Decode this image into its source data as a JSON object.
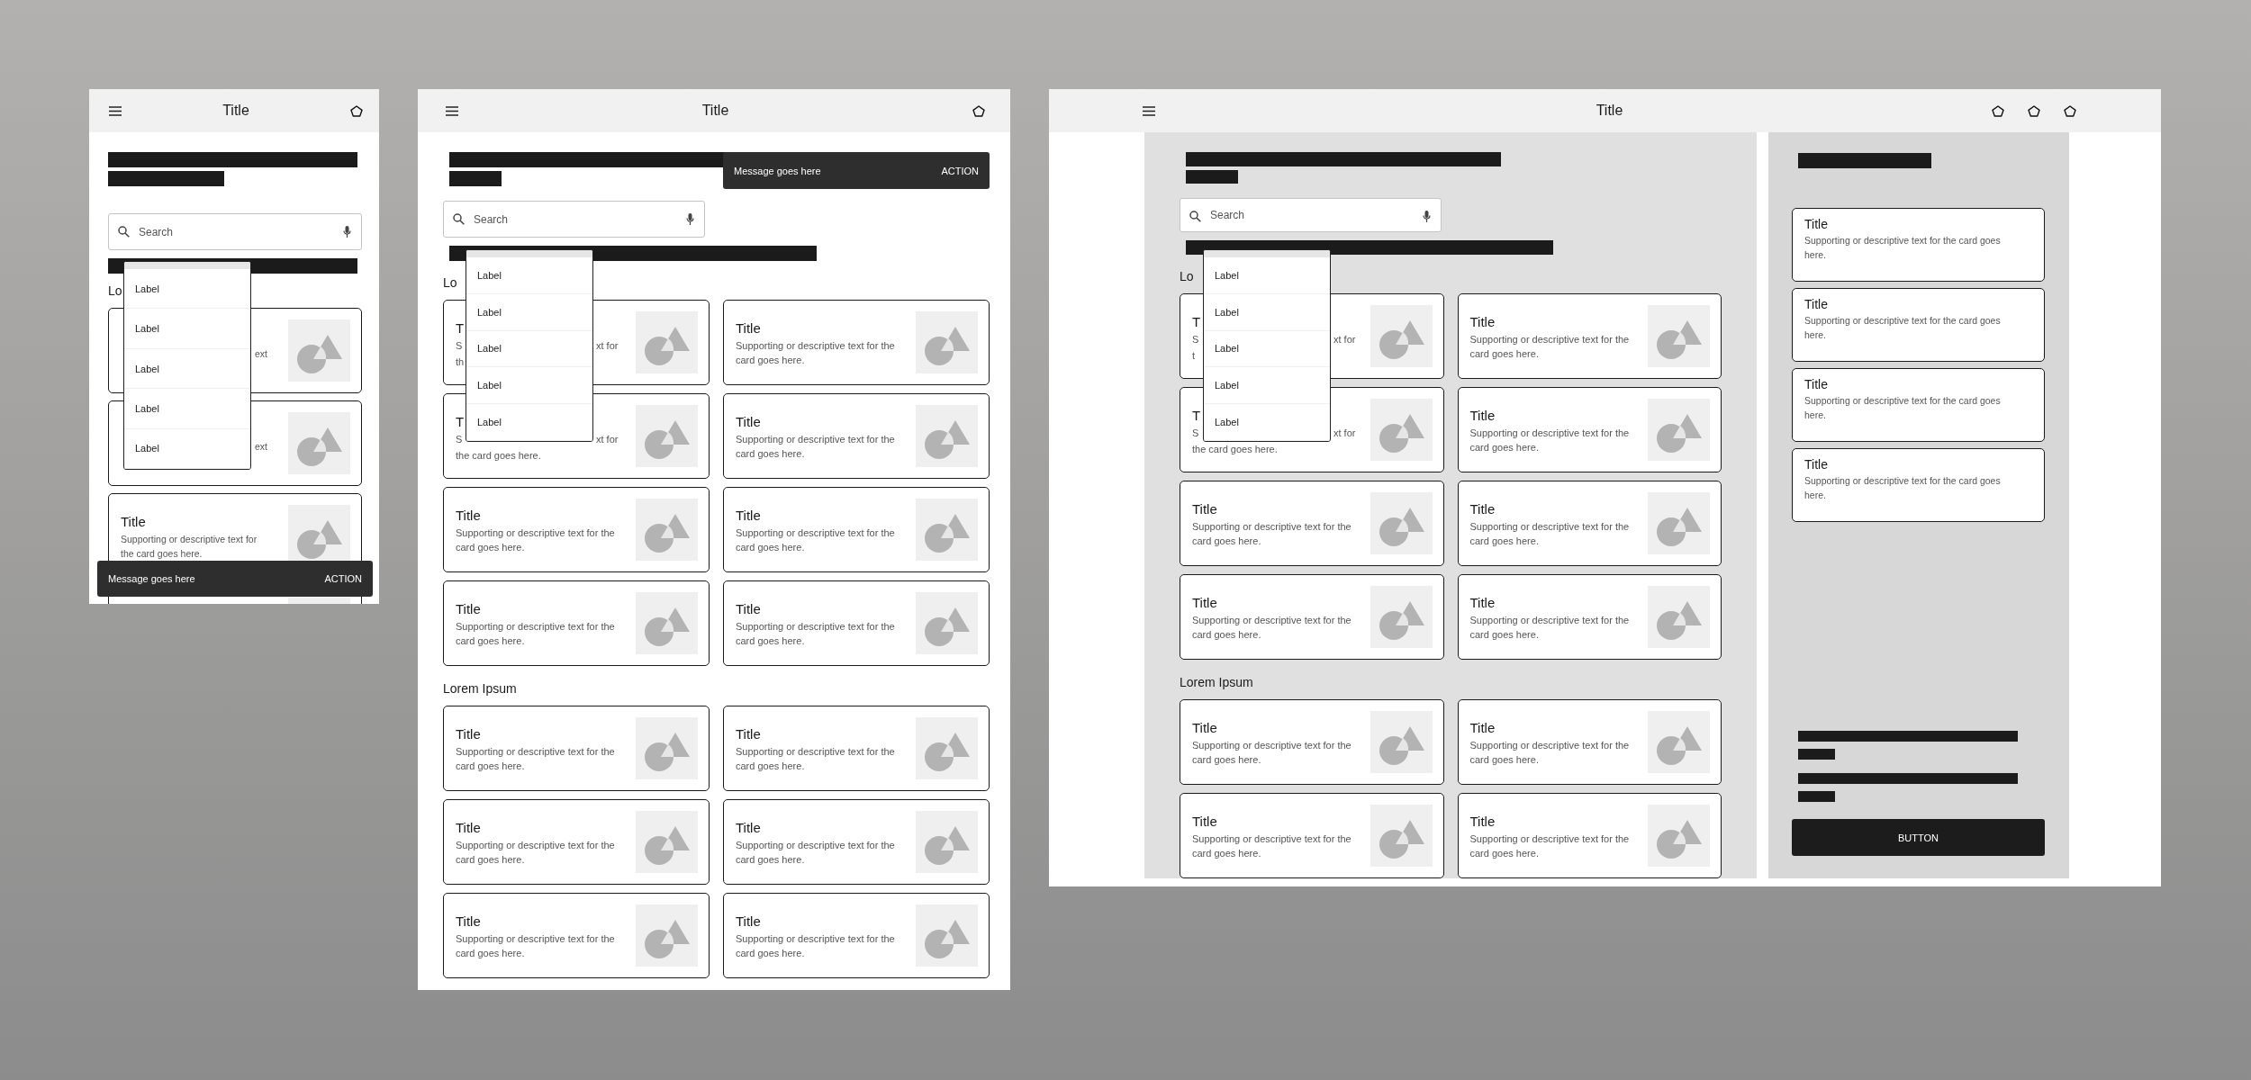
{
  "screens": [
    {
      "kind": "mobile",
      "title": "Title",
      "search": {
        "placeholder": "Search"
      },
      "menu": {
        "items": [
          {
            "label": "Label"
          },
          {
            "label": "Label"
          },
          {
            "label": "Label"
          },
          {
            "label": "Label"
          },
          {
            "label": "Label"
          }
        ]
      },
      "sections": [
        {
          "heading": "Lo",
          "cards": [
            {
              "kind": "covered",
              "lines": [
                {
                  "right": "ext"
                }
              ]
            },
            {
              "kind": "covered",
              "lines": [
                {
                  "right": "ext"
                }
              ]
            },
            {
              "kind": "full",
              "title": "Title",
              "text": "Supporting or descriptive text for the card goes here."
            },
            {
              "kind": "cut"
            }
          ]
        }
      ],
      "snackbar": {
        "message": "Message goes here",
        "action": "ACTION"
      }
    },
    {
      "kind": "tablet",
      "title": "Title",
      "search": {
        "placeholder": "Search"
      },
      "menu": {
        "items": [
          {
            "label": "Label"
          },
          {
            "label": "Label"
          },
          {
            "label": "Label"
          },
          {
            "label": "Label"
          },
          {
            "label": "Label"
          }
        ]
      },
      "sections": [
        {
          "heading": "Lo",
          "cards": [
            {
              "kind": "covered",
              "title": "T",
              "lines": [
                {
                  "left": "S",
                  "right": "xt for"
                },
                {
                  "left": "th"
                }
              ]
            },
            {
              "kind": "full",
              "title": "Title",
              "text": "Supporting or descriptive text for the card goes here."
            },
            {
              "kind": "covered",
              "title": "T",
              "lines": [
                {
                  "left": "S",
                  "right": "xt for"
                },
                {
                  "left": "the card goes here."
                }
              ]
            },
            {
              "kind": "full",
              "title": "Title",
              "text": "Supporting or descriptive text for the card goes here."
            },
            {
              "kind": "full",
              "title": "Title",
              "text": "Supporting or descriptive text for the card goes here."
            },
            {
              "kind": "full",
              "title": "Title",
              "text": "Supporting or descriptive text for the card goes here."
            },
            {
              "kind": "full",
              "title": "Title",
              "text": "Supporting or descriptive text for the card goes here."
            },
            {
              "kind": "full",
              "title": "Title",
              "text": "Supporting or descriptive text for the card goes here."
            }
          ]
        },
        {
          "heading": "Lorem Ipsum",
          "cards": [
            {
              "kind": "full",
              "title": "Title",
              "text": "Supporting or descriptive text for the card goes here."
            },
            {
              "kind": "full",
              "title": "Title",
              "text": "Supporting or descriptive text for the card goes here."
            },
            {
              "kind": "full",
              "title": "Title",
              "text": "Supporting or descriptive text for the card goes here."
            },
            {
              "kind": "full",
              "title": "Title",
              "text": "Supporting or descriptive text for the card goes here."
            },
            {
              "kind": "full",
              "title": "Title",
              "text": "Supporting or descriptive text for the card goes here."
            },
            {
              "kind": "full",
              "title": "Title",
              "text": "Supporting or descriptive text for the card goes here."
            }
          ]
        }
      ],
      "snackbar": {
        "message": "Message goes here",
        "action": "ACTION"
      }
    },
    {
      "kind": "desktop",
      "title": "Title",
      "search": {
        "placeholder": "Search"
      },
      "menu": {
        "items": [
          {
            "label": "Label"
          },
          {
            "label": "Label"
          },
          {
            "label": "Label"
          },
          {
            "label": "Label"
          },
          {
            "label": "Label"
          }
        ]
      },
      "sections": [
        {
          "heading": "Lo",
          "cards": [
            {
              "kind": "covered",
              "title": "T",
              "lines": [
                {
                  "left": "S",
                  "right": "xt for"
                },
                {
                  "left": "t"
                }
              ]
            },
            {
              "kind": "full",
              "title": "Title",
              "text": "Supporting or descriptive text for the card goes here."
            },
            {
              "kind": "covered",
              "title": "T",
              "lines": [
                {
                  "left": "S",
                  "right": "xt for"
                },
                {
                  "left": "the card goes here."
                }
              ]
            },
            {
              "kind": "full",
              "title": "Title",
              "text": "Supporting or descriptive text for the card goes here."
            },
            {
              "kind": "full",
              "title": "Title",
              "text": "Supporting or descriptive text for the card goes here."
            },
            {
              "kind": "full",
              "title": "Title",
              "text": "Supporting or descriptive text for the card goes here."
            },
            {
              "kind": "full",
              "title": "Title",
              "text": "Supporting or descriptive text for the card goes here."
            },
            {
              "kind": "full",
              "title": "Title",
              "text": "Supporting or descriptive text for the card goes here."
            }
          ]
        },
        {
          "heading": "Lorem Ipsum",
          "cards": [
            {
              "kind": "full",
              "title": "Title",
              "text": "Supporting or descriptive text for the card goes here."
            },
            {
              "kind": "full",
              "title": "Title",
              "text": "Supporting or descriptive text for the card goes here."
            },
            {
              "kind": "full",
              "title": "Title",
              "text": "Supporting or descriptive text for the card goes here."
            },
            {
              "kind": "full",
              "title": "Title",
              "text": "Supporting or descriptive text for the card goes here."
            }
          ]
        }
      ],
      "sidebar": {
        "cards": [
          {
            "title": "Title",
            "text": "Supporting or descriptive text for the card goes here."
          },
          {
            "title": "Title",
            "text": "Supporting or descriptive text for the card goes here."
          },
          {
            "title": "Title",
            "text": "Supporting or descriptive text for the card goes here."
          },
          {
            "title": "Title",
            "text": "Supporting or descriptive text for the card goes here."
          }
        ],
        "button": "BUTTON"
      }
    }
  ]
}
